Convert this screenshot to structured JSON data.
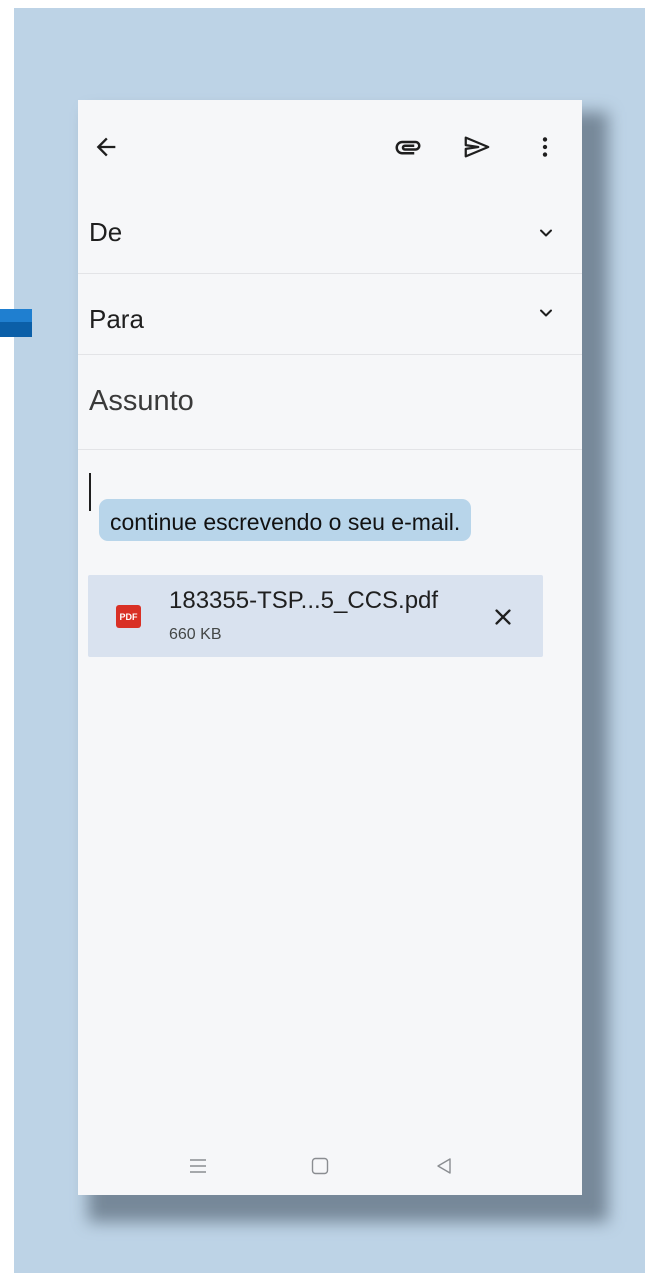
{
  "compose": {
    "from_label": "De",
    "to_label": "Para",
    "subject_placeholder": "Assunto",
    "smart_compose_suggestion": "continue escrevendo o seu e-mail."
  },
  "toolbar": {
    "back_icon": "arrow-back-icon",
    "attach_icon": "paperclip-icon",
    "send_icon": "send-icon",
    "more_icon": "more-vertical-icon"
  },
  "attachment": {
    "type_badge": "PDF",
    "file_name": "183355-TSP...5_CCS.pdf",
    "file_size": "660 KB"
  },
  "system_nav": {
    "icons": [
      "menu-icon",
      "home-icon",
      "back-triangle-icon"
    ]
  },
  "colors": {
    "backdrop": "#bdd3e6",
    "suggestion_highlight": "#b8d5ea",
    "attachment_background": "#d9e2ef",
    "pdf_badge": "#d93025"
  }
}
